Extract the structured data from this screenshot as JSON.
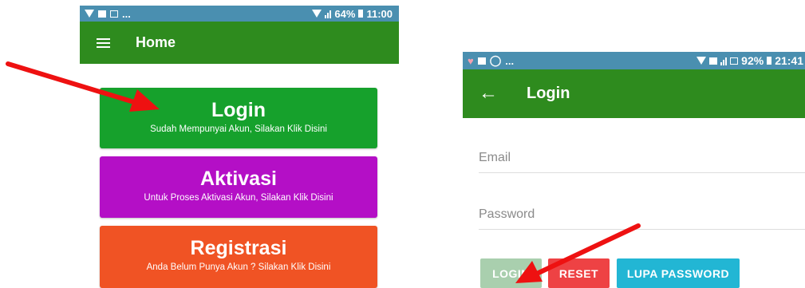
{
  "home_screen": {
    "status_bar": {
      "battery": "64%",
      "time": "11:00",
      "notification_ellipsis": "..."
    },
    "app_bar": {
      "title": "Home"
    },
    "buttons": [
      {
        "title": "Login",
        "subtitle": "Sudah Mempunyai Akun, Silakan Klik Disini",
        "color": "#16a12c"
      },
      {
        "title": "Aktivasi",
        "subtitle": "Untuk Proses Aktivasi Akun, Silakan Klik Disini",
        "color": "#b40fc6"
      },
      {
        "title": "Registrasi",
        "subtitle": "Anda Belum Punya Akun ? Silakan Klik Disini",
        "color": "#f05324"
      }
    ]
  },
  "login_screen": {
    "status_bar": {
      "battery": "92%",
      "time": "21:41",
      "notification_ellipsis": "..."
    },
    "app_bar": {
      "title": "Login",
      "back_icon": "arrow-back-icon"
    },
    "form": {
      "email_placeholder": "Email",
      "password_placeholder": "Password",
      "login_label": "LOGIN",
      "reset_label": "RESET",
      "forgot_label": "LUPA PASSWORD"
    }
  },
  "colors": {
    "status_bar": "#4a8fb0",
    "app_bar": "#2e8b1e",
    "annotation_arrow": "#ee1111"
  }
}
